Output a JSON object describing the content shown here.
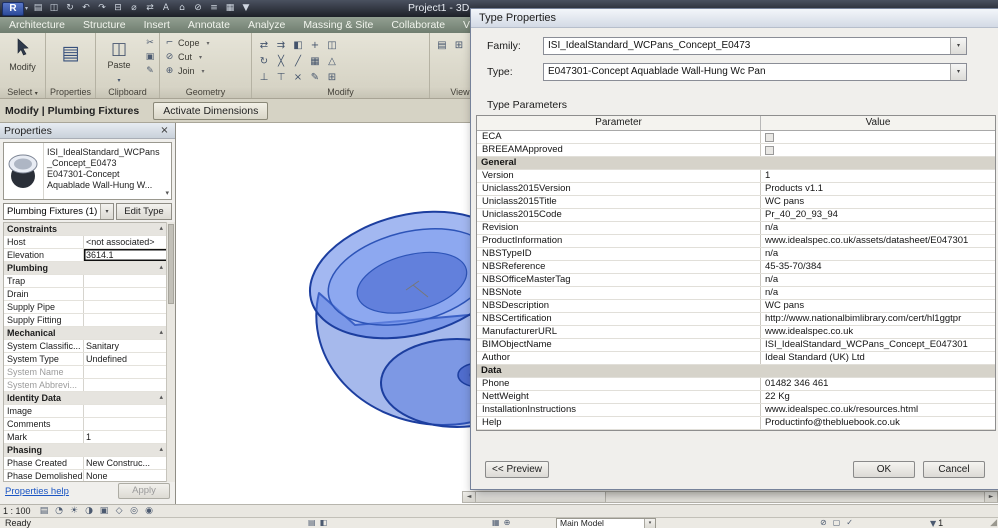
{
  "ui": {
    "dropdown": "▾",
    "chevron": "▴",
    "scroll_left": "◄",
    "scroll_right": "►",
    "close": "×",
    "grip": "◢"
  },
  "titlebar": {
    "app_button": "R",
    "title": "Project1 - 3D",
    "quick_icons": [
      {
        "name": "open-icon",
        "glyph": "▤"
      },
      {
        "name": "save-icon",
        "glyph": "◫"
      },
      {
        "name": "sync-icon",
        "glyph": "↻"
      },
      {
        "name": "undo-icon",
        "glyph": "↶"
      },
      {
        "name": "redo-icon",
        "glyph": "↷"
      },
      {
        "name": "print-icon",
        "glyph": "⊟"
      },
      {
        "name": "measure-icon",
        "glyph": "⌀"
      },
      {
        "name": "dimension-icon",
        "glyph": "⇄"
      },
      {
        "name": "text-icon",
        "glyph": "A"
      },
      {
        "name": "3d-view-icon",
        "glyph": "⌂"
      },
      {
        "name": "section-icon",
        "glyph": "⊘"
      },
      {
        "name": "thin-lines-icon",
        "glyph": "≡"
      },
      {
        "name": "switch-windows-icon",
        "glyph": "▦"
      },
      {
        "name": "toolbar-options-icon",
        "glyph": "▼"
      }
    ]
  },
  "tabs": [
    {
      "label": "Architecture"
    },
    {
      "label": "Structure"
    },
    {
      "label": "Insert"
    },
    {
      "label": "Annotate"
    },
    {
      "label": "Analyze"
    },
    {
      "label": "Massing & Site"
    },
    {
      "label": "Collaborate"
    },
    {
      "label": "View"
    }
  ],
  "ribbon": {
    "select": {
      "label": "Select",
      "big_button": "Modify",
      "big_glyph": "➤"
    },
    "properties": {
      "label": "Properties",
      "big_glyph": "▤"
    },
    "clipboard": {
      "label": "Clipboard",
      "big_button": "Paste",
      "big_glyph": "◫",
      "small_icons": [
        {
          "name": "cut-icon",
          "glyph": "✂"
        },
        {
          "name": "copy-icon",
          "glyph": "▣"
        },
        {
          "name": "match-type-icon",
          "glyph": "✎"
        }
      ]
    },
    "geometry": {
      "label": "Geometry",
      "buttons": [
        {
          "name": "cope-button",
          "glyph": "⌐",
          "label": "Cope"
        },
        {
          "name": "cut-geometry-button",
          "glyph": "⊘",
          "label": "Cut"
        },
        {
          "name": "join-button",
          "glyph": "⊕",
          "label": "Join"
        }
      ]
    },
    "modify": {
      "label": "Modify",
      "icons": [
        {
          "name": "align-icon",
          "glyph": "⇄"
        },
        {
          "name": "offset-icon",
          "glyph": "⇉"
        },
        {
          "name": "mirror-icon",
          "glyph": "◧"
        },
        {
          "name": "move-icon",
          "glyph": "+"
        },
        {
          "name": "copy-icon",
          "glyph": "◫"
        },
        {
          "name": "rotate-icon",
          "glyph": "↻"
        },
        {
          "name": "trim-icon",
          "glyph": "╳"
        },
        {
          "name": "split-icon",
          "glyph": "╱"
        },
        {
          "name": "array-icon",
          "glyph": "▦"
        },
        {
          "name": "scale-icon",
          "glyph": "△"
        },
        {
          "name": "pin-icon",
          "glyph": "⊥"
        },
        {
          "name": "unpin-icon",
          "glyph": "⊤"
        },
        {
          "name": "delete-icon",
          "glyph": "×"
        },
        {
          "name": "paint-icon",
          "glyph": "✎"
        },
        {
          "name": "join-geometry-icon",
          "glyph": "⊞"
        }
      ]
    },
    "view": {
      "label": "View",
      "icons": [
        {
          "name": "view-templates-icon",
          "glyph": "▤"
        },
        {
          "name": "user-interface-icon",
          "glyph": "⊞"
        }
      ]
    }
  },
  "optionsbar": {
    "context": "Modify | Plumbing Fixtures",
    "activate_dimensions": "Activate Dimensions"
  },
  "palette": {
    "header": "Properties",
    "type_selector": {
      "line1": "ISI_IdealStandard_WCPans",
      "line2": "_Concept_E0473",
      "line3": "E047301-Concept",
      "line4": "Aquablade Wall-Hung W..."
    },
    "filter": "Plumbing Fixtures (1)",
    "edit_type": "Edit Type",
    "rows": [
      {
        "cls": "group",
        "name": "Constraints"
      },
      {
        "name": "Host",
        "value": "<not associated>"
      },
      {
        "cls": "sel",
        "name": "Elevation",
        "value": "3614.1"
      },
      {
        "cls": "group",
        "name": "Plumbing"
      },
      {
        "name": "Trap",
        "value": ""
      },
      {
        "name": "Drain",
        "value": ""
      },
      {
        "name": "Supply Pipe",
        "value": ""
      },
      {
        "name": "Supply Fitting",
        "value": ""
      },
      {
        "cls": "group",
        "name": "Mechanical"
      },
      {
        "name": "System Classific...",
        "value": "Sanitary"
      },
      {
        "name": "System Type",
        "value": "Undefined"
      },
      {
        "cls": "dim",
        "name": "System Name",
        "value": ""
      },
      {
        "cls": "dim",
        "name": "System Abbrevi...",
        "value": ""
      },
      {
        "cls": "group",
        "name": "Identity Data"
      },
      {
        "name": "Image",
        "value": ""
      },
      {
        "name": "Comments",
        "value": ""
      },
      {
        "name": "Mark",
        "value": "1"
      },
      {
        "cls": "group",
        "name": "Phasing"
      },
      {
        "name": "Phase Created",
        "value": "New Construc..."
      },
      {
        "name": "Phase Demolished",
        "value": "None"
      }
    ],
    "help_link": "Properties help",
    "apply": "Apply"
  },
  "dialog": {
    "title": "Type Properties",
    "family_label": "Family:",
    "family_value": "ISI_IdealStandard_WCPans_Concept_E0473",
    "type_label": "Type:",
    "type_value": "E047301-Concept Aquablade Wall-Hung Wc Pan",
    "section_label": "Type Parameters",
    "col_parameter": "Parameter",
    "col_value": "Value",
    "params": [
      {
        "cls": "check",
        "name": "ECA",
        "value": ""
      },
      {
        "cls": "check",
        "name": "BREEAMApproved",
        "value": ""
      },
      {
        "cls": "group",
        "name": "General",
        "value": ""
      },
      {
        "name": "Version",
        "value": "1"
      },
      {
        "name": "Uniclass2015Version",
        "value": "Products v1.1"
      },
      {
        "name": "Uniclass2015Title",
        "value": "WC pans"
      },
      {
        "name": "Uniclass2015Code",
        "value": "Pr_40_20_93_94"
      },
      {
        "name": "Revision",
        "value": "n/a"
      },
      {
        "name": "ProductInformation",
        "value": "www.idealspec.co.uk/assets/datasheet/E047301"
      },
      {
        "name": "NBSTypeID",
        "value": "n/a"
      },
      {
        "name": "NBSReference",
        "value": "45-35-70/384"
      },
      {
        "name": "NBSOfficeMasterTag",
        "value": "n/a"
      },
      {
        "name": "NBSNote",
        "value": "n/a"
      },
      {
        "name": "NBSDescription",
        "value": "WC pans"
      },
      {
        "name": "NBSCertification",
        "value": "http://www.nationalbimlibrary.com/cert/hl1ggtpr"
      },
      {
        "name": "ManufacturerURL",
        "value": "www.idealspec.co.uk"
      },
      {
        "name": "BIMObjectName",
        "value": "ISI_IdealStandard_WCPans_Concept_E047301"
      },
      {
        "name": "Author",
        "value": "Ideal Standard (UK) Ltd"
      },
      {
        "cls": "group",
        "name": "Data",
        "value": ""
      },
      {
        "name": "Phone",
        "value": "01482 346 461"
      },
      {
        "name": "NettWeight",
        "value": "22 Kg"
      },
      {
        "name": "InstallationInstructions",
        "value": "www.idealspec.co.uk/resources.html"
      },
      {
        "name": "Help",
        "value": "Productinfo@thebluebook.co.uk"
      }
    ],
    "preview_button": "<< Preview",
    "ok_button": "OK",
    "cancel_button": "Cancel"
  },
  "view_bar": {
    "scale": "1 : 100",
    "icons": [
      {
        "name": "detail-level-icon",
        "glyph": "▤"
      },
      {
        "name": "visual-style-icon",
        "glyph": "◔"
      },
      {
        "name": "sun-path-icon",
        "glyph": "☀"
      },
      {
        "name": "shadows-icon",
        "glyph": "◑"
      },
      {
        "name": "crop-view-icon",
        "glyph": "▣"
      },
      {
        "name": "show-crop-icon",
        "glyph": "◇"
      },
      {
        "name": "temporary-hide-icon",
        "glyph": "◎"
      },
      {
        "name": "reveal-hidden-icon",
        "glyph": "◉"
      }
    ]
  },
  "statusbar": {
    "message": "Ready",
    "mid_icons": [
      {
        "name": "worksets-icon",
        "glyph": "▤"
      },
      {
        "name": "design-options-icon",
        "glyph": "◧"
      }
    ],
    "model_icons": [
      {
        "name": "active-workset-icon",
        "glyph": "▦"
      },
      {
        "name": "link-icon",
        "glyph": "⊕"
      }
    ],
    "design_option": "Main Model",
    "right_icons": [
      {
        "name": "exclude-options-icon",
        "glyph": "⊘"
      },
      {
        "name": "editable-only-icon",
        "glyph": "▢"
      },
      {
        "name": "press-drag-icon",
        "glyph": "✓"
      }
    ],
    "filter_glyph": "▼",
    "selection_count": "1"
  }
}
